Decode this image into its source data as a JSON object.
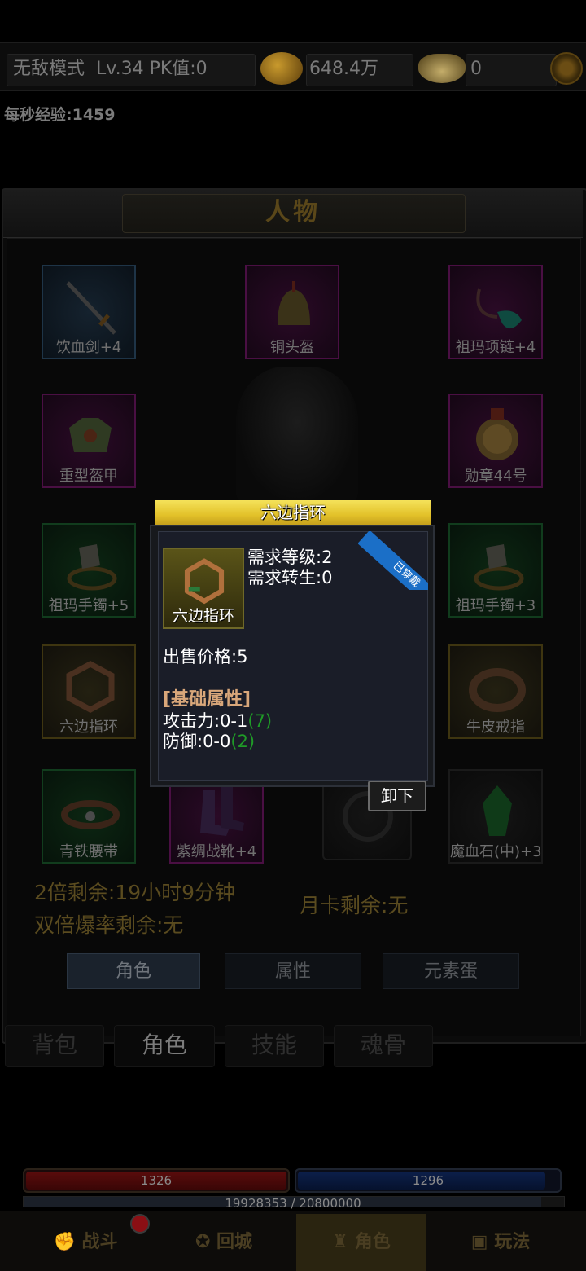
{
  "top": {
    "mode": "无敌模式",
    "level_pk": "Lv.34 PK值:0",
    "gold": "648.4万",
    "ingots": "0",
    "exp_per_sec": "每秒经验:1459"
  },
  "panel": {
    "title": "人物",
    "slots": [
      {
        "label": "饮血剑+4"
      },
      {
        "label": "铜头盔"
      },
      {
        "label": "祖玛项链+4"
      },
      {
        "label": "重型盔甲"
      },
      {
        "label": "勋章44号"
      },
      {
        "label": "祖玛手镯+5"
      },
      {
        "label": "祖玛手镯+3"
      },
      {
        "label": "六边指环"
      },
      {
        "label": "牛皮戒指"
      },
      {
        "label": "青铁腰带"
      },
      {
        "label": "紫绸战靴+4"
      },
      {
        "label": "魔血石(中)+3"
      }
    ],
    "double_remaining": "2倍剩余:19小时9分钟",
    "double_drop_remaining": "双倍爆率剩余:无",
    "month_card": "月卡剩余:无",
    "sub_tabs": [
      "角色",
      "属性",
      "元素蛋"
    ],
    "bottom_tabs": [
      "背包",
      "角色",
      "技能",
      "魂骨"
    ]
  },
  "popup": {
    "title": "六边指环",
    "item_label": "六边指环",
    "req_level": "需求等级:2",
    "req_rebirth": "需求转生:0",
    "badge": "已穿戴",
    "price": "出售价格:5",
    "section": "[基础属性]",
    "attack": "攻击力:0-1",
    "attack_bonus": "(7)",
    "defense": "防御:0-0",
    "defense_bonus": "(2)",
    "unequip": "卸下"
  },
  "bars": {
    "hp": "1326",
    "hp_fill": 1.0,
    "mp": "1296",
    "mp_fill": 0.95,
    "exp": "19928353 / 20800000",
    "exp_fill": 0.958
  },
  "nav": [
    "战斗",
    "回城",
    "角色",
    "玩法"
  ],
  "colors": {
    "accent_gold": "#e3c22a",
    "bonus_green": "#1f9b27",
    "ribbon_blue": "#1b6fc7"
  }
}
